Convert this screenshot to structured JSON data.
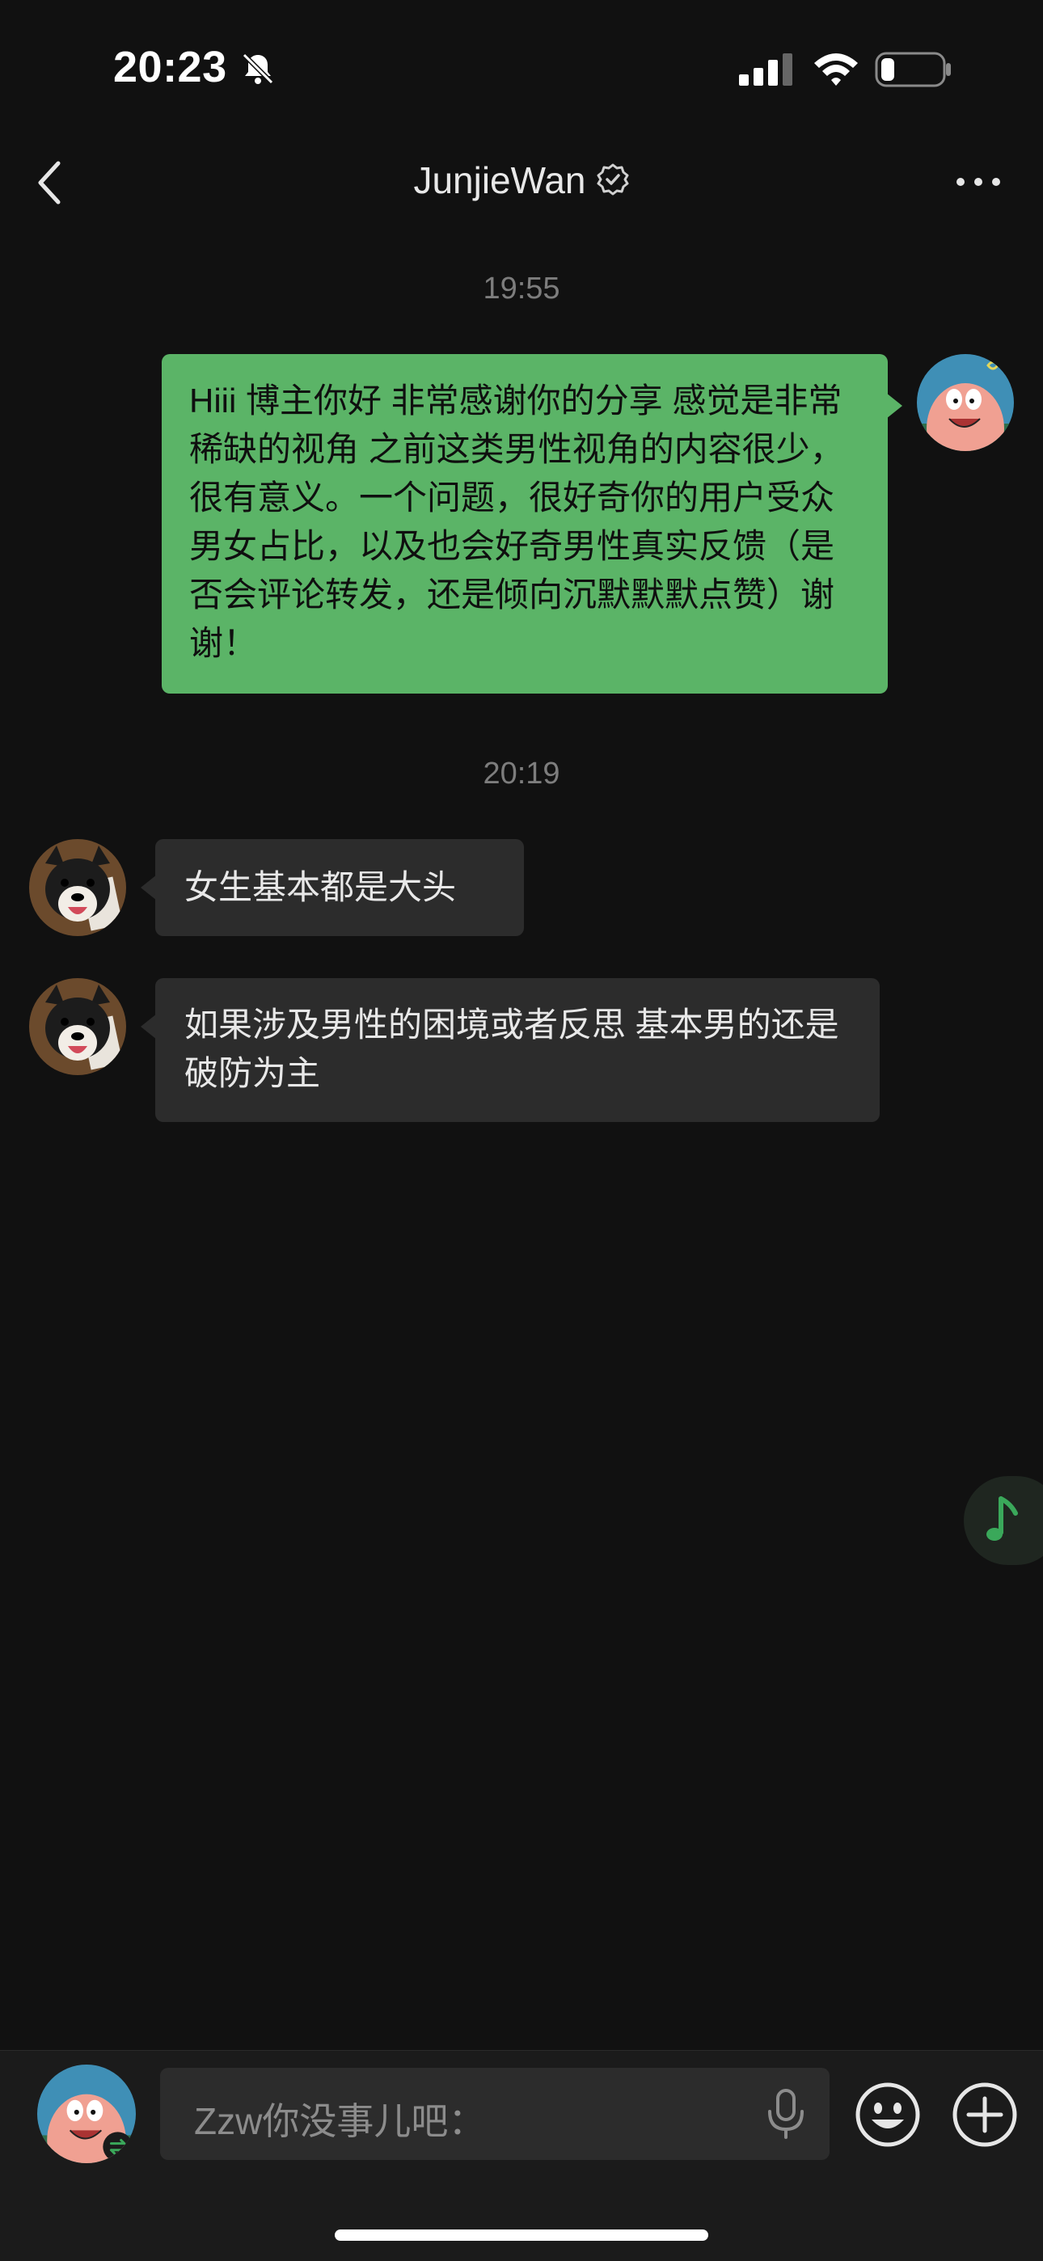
{
  "status_bar": {
    "time": "20:23"
  },
  "header": {
    "title": "JunjieWan"
  },
  "messages": {
    "ts1": "19:55",
    "sent1": "Hiii 博主你好 非常感谢你的分享 感觉是非常稀缺的视角 之前这类男性视角的内容很少，很有意义。一个问题，很好奇你的用户受众男女占比，以及也会好奇男性真实反馈（是否会评论转发，还是倾向沉默默默点赞）谢谢！",
    "ts2": "20:19",
    "recv1": "女生基本都是大头",
    "recv2": "如果涉及男性的困境或者反思 基本男的还是破防为主"
  },
  "input": {
    "text": "Zzw你没事儿吧："
  },
  "colors": {
    "sent_bubble": "#5bb467",
    "recv_bubble": "#2c2c2c",
    "background": "#111111"
  },
  "icons": [
    "bell-slash-icon",
    "signal-icon",
    "wifi-icon",
    "battery-icon",
    "back-chevron-icon",
    "verified-icon",
    "more-icon",
    "music-note-icon",
    "mic-icon",
    "emoji-icon",
    "plus-icon"
  ]
}
